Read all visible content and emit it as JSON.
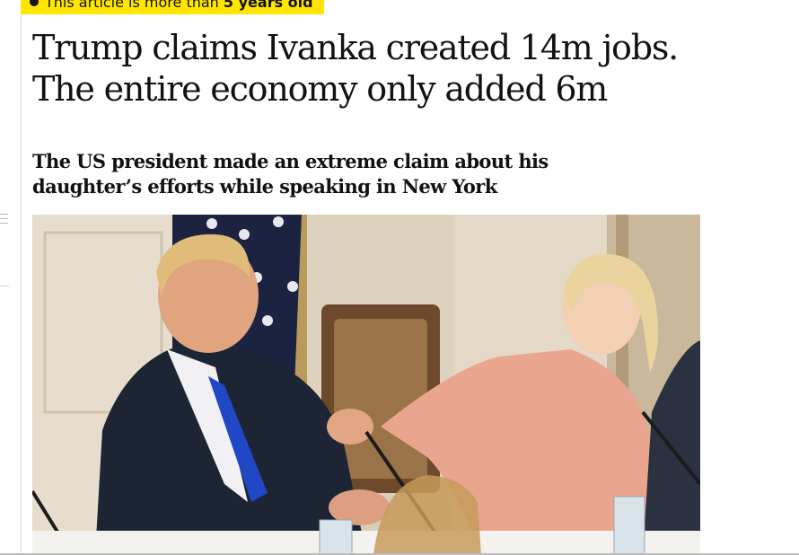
{
  "age_warning": {
    "prefix": "This article is more than ",
    "emphasis": "5 years old"
  },
  "headline": {
    "line1": "Trump claims Ivanka created 14m jobs.",
    "line2": "The entire economy only added 6m"
  },
  "standfirst": {
    "line1": "The US president made an extreme claim about his",
    "line2": "daughter’s efforts while speaking in New York"
  },
  "image": {
    "alt": "Donald Trump and Ivanka Trump seated at a table holding hands"
  },
  "colors": {
    "badge": "#ffe500",
    "text": "#121212"
  }
}
